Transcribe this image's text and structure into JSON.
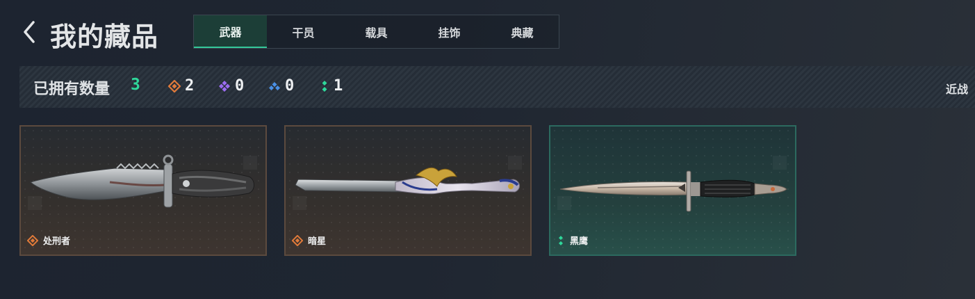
{
  "header": {
    "title": "我的藏品",
    "tabs": [
      {
        "label": "武器",
        "active": true
      },
      {
        "label": "干员",
        "active": false
      },
      {
        "label": "载具",
        "active": false
      },
      {
        "label": "挂饰",
        "active": false
      },
      {
        "label": "典藏",
        "active": false
      }
    ]
  },
  "stats": {
    "owned_label": "已拥有数量",
    "owned_count": "3",
    "rarities": [
      {
        "icon": "orange-diamond-icon",
        "color": "#e07a3a",
        "count": "2"
      },
      {
        "icon": "purple-diamond-icon",
        "color": "#9b6cf0",
        "count": "0"
      },
      {
        "icon": "blue-diamond-icon",
        "color": "#4a90e6",
        "count": "0"
      },
      {
        "icon": "green-diamond-icon",
        "color": "#2fd79a",
        "count": "1"
      }
    ],
    "category": "近战"
  },
  "cards": [
    {
      "name": "处刑者",
      "rarity_icon": "orange-diamond-icon",
      "rarity_color": "#e07a3a",
      "weapon": "combat-knife-image"
    },
    {
      "name": "暗星",
      "rarity_icon": "orange-diamond-icon",
      "rarity_color": "#e07a3a",
      "weapon": "ornate-knife-image"
    },
    {
      "name": "黑鹰",
      "rarity_icon": "green-diamond-icon",
      "rarity_color": "#2fd79a",
      "weapon": "bayonet-knife-image"
    }
  ],
  "colors": {
    "accent_green": "#34c89a",
    "tab_active_bg": "#1c3e37",
    "card_border_orange": "#5c4a3e",
    "card_border_green": "#2c6a5f"
  }
}
